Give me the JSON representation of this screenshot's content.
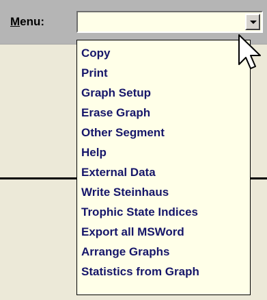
{
  "toolbar": {
    "menu_label_accel": "M",
    "menu_label_rest": "enu:"
  },
  "combo": {
    "value": "",
    "arrow_icon": "chevron-down-icon"
  },
  "dropdown": {
    "items": [
      "Copy",
      "Print",
      "Graph Setup",
      "Erase Graph",
      "Other Segment",
      "Help",
      "External Data",
      "Write Steinhaus",
      "Trophic State Indices",
      "Export all MSWord",
      "Arrange Graphs",
      "Statistics from Graph"
    ]
  },
  "colors": {
    "toolbar_bg": "#b5b5b5",
    "page_bg": "#ece9d8",
    "dropdown_bg": "#ffffe8",
    "item_text": "#16166a"
  }
}
